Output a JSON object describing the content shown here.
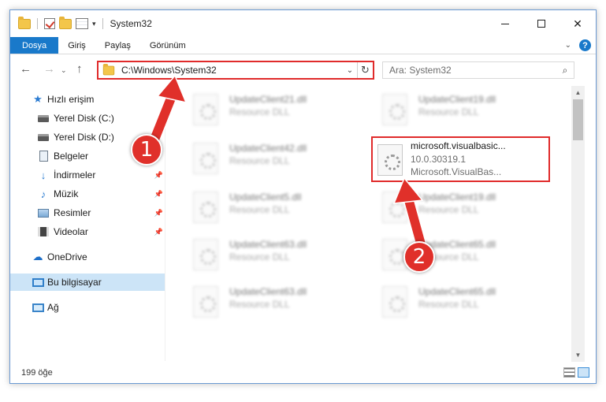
{
  "window": {
    "title": "System32"
  },
  "ribbon": {
    "tabs": [
      {
        "label": "Dosya",
        "active": true
      },
      {
        "label": "Giriş"
      },
      {
        "label": "Paylaş"
      },
      {
        "label": "Görünüm"
      }
    ],
    "help": "?"
  },
  "address": {
    "path": "C:\\Windows\\System32"
  },
  "search": {
    "placeholder": "Ara: System32"
  },
  "sidebar": {
    "items": [
      {
        "label": "Hızlı erişim",
        "icon": "star-icon"
      },
      {
        "label": "Yerel Disk (C:)",
        "icon": "disk-icon"
      },
      {
        "label": "Yerel Disk (D:)",
        "icon": "disk-icon"
      },
      {
        "label": "Belgeler",
        "icon": "document-icon"
      },
      {
        "label": "İndirmeler",
        "icon": "download-icon",
        "pinned": true
      },
      {
        "label": "Müzik",
        "icon": "music-icon",
        "pinned": true
      },
      {
        "label": "Resimler",
        "icon": "pictures-icon",
        "pinned": true
      },
      {
        "label": "Videolar",
        "icon": "videos-icon",
        "pinned": true
      },
      {
        "label": "OneDrive",
        "icon": "cloud-icon"
      },
      {
        "label": "Bu bilgisayar",
        "icon": "computer-icon",
        "selected": true
      },
      {
        "label": "Ağ",
        "icon": "network-icon"
      }
    ]
  },
  "files": [
    {
      "name": "UpdateClient21.dll",
      "type": "Resource DLL"
    },
    {
      "name": "UpdateClient19.dll",
      "type": "Resource DLL"
    },
    {
      "name": "UpdateClient42.dll",
      "type": "Resource DLL"
    },
    {
      "name": "microsoft.visualbasic...",
      "version": "10.0.30319.1",
      "desc": "Microsoft.VisualBas...",
      "highlighted": true
    },
    {
      "name": "UpdateClient5.dll",
      "type": "Resource DLL"
    },
    {
      "name": "UpdateClient19.dll",
      "type": "Resource DLL"
    },
    {
      "name": "UpdateClient63.dll",
      "type": "Resource DLL"
    },
    {
      "name": "UpdateClient65.dll",
      "type": "Resource DLL"
    },
    {
      "name": "UpdateClient63.dll",
      "type": "Resource DLL"
    },
    {
      "name": "UpdateClient65.dll",
      "type": "Resource DLL"
    }
  ],
  "status": {
    "count": "199 öğe"
  },
  "annotations": [
    {
      "number": "1",
      "color": "#e0302a"
    },
    {
      "number": "2",
      "color": "#e0302a"
    }
  ],
  "colors": {
    "accent": "#1979ca",
    "highlight": "#e02b2b",
    "selection": "#cce4f7"
  }
}
